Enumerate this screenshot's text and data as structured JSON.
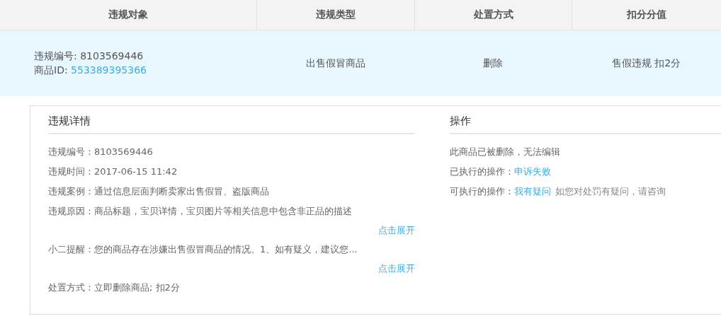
{
  "table": {
    "columns": [
      "违规对象",
      "违规类型",
      "处置方式",
      "扣分分值"
    ],
    "row": {
      "object": [
        {
          "label": "违规编号: ",
          "value": "8103569446",
          "link": false
        },
        {
          "label": "商品ID: ",
          "value": "553389395366",
          "link": true
        }
      ],
      "type": "出售假冒商品",
      "action": "删除",
      "points": "售假违规 扣2分"
    }
  },
  "details": {
    "title": "违规详情",
    "items": [
      {
        "kind": "field",
        "label": "违规编号：",
        "value": "8103569446"
      },
      {
        "kind": "field",
        "label": "违规时间：",
        "value": "2017-06-15 11:42"
      },
      {
        "kind": "field",
        "label": "违规案例：",
        "value": "通过信息层面判断卖家出售假冒、盗版商品"
      },
      {
        "kind": "field",
        "label": "违规原因：",
        "value": "商品标题，宝贝详情，宝贝图片等相关信息中包含非正品的描述"
      },
      {
        "kind": "expand",
        "label": "点击展开"
      },
      {
        "kind": "field",
        "label": "小二提醒：",
        "value": "您的商品存在涉嫌出售假冒商品的情况。1、如有疑义，建议您..."
      },
      {
        "kind": "expand",
        "label": "点击展开"
      },
      {
        "kind": "field",
        "label": "处置方式：",
        "value": "立即删除商品; 扣2分"
      }
    ]
  },
  "operations": {
    "title": "操作",
    "lines": [
      {
        "kind": "note",
        "text": "此商品已被删除，无法编辑"
      },
      {
        "kind": "status",
        "label": "已执行的操作：",
        "link": "申诉失败"
      },
      {
        "kind": "action",
        "label": "可执行的操作：",
        "link": "我有疑问",
        "hint": "如您对处罚有疑问，请咨询"
      }
    ]
  }
}
